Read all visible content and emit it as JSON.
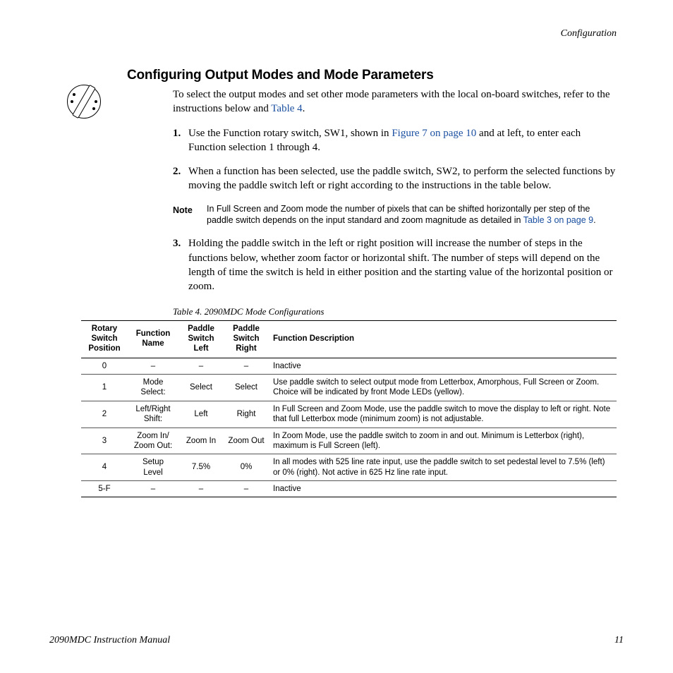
{
  "header": {
    "category": "Configuration"
  },
  "heading": "Configuring Output Modes and Mode Parameters",
  "intro": {
    "pre": "To select the output modes and set other mode parameters with the local on-board switches, refer to the instructions below and ",
    "xref": "Table 4",
    "post": "."
  },
  "steps": {
    "s1": {
      "num": "1.",
      "pre": "Use the Function rotary switch, SW1, shown in ",
      "xref": "Figure 7 on page 10",
      "post": " and at left, to enter each Function selection 1 through 4."
    },
    "s2": {
      "num": "2.",
      "text": "When a function has been selected, use the paddle switch, SW2, to perform the selected functions by moving the paddle switch left or right according to the instructions in the table below."
    },
    "s3": {
      "num": "3.",
      "text": "Holding the paddle switch in the left or right position will increase the number of steps in the functions below, whether zoom factor or horizontal shift. The number of steps will depend on the length of time the switch is held in either position and the starting value of the horizontal position or zoom."
    }
  },
  "note": {
    "label": "Note",
    "pre": "In Full Screen and Zoom mode the number of pixels that can be shifted horizontally per step of the paddle switch depends on the input standard and zoom magnitude as detailed in ",
    "xref": "Table 3 on page 9",
    "post": "."
  },
  "table": {
    "caption": "Table 4.  2090MDC Mode Configurations",
    "headers": {
      "pos": "Rotary Switch Position",
      "fn": "Function Name",
      "pl": "Paddle Switch Left",
      "pr": "Paddle Switch Right",
      "desc": "Function Description"
    },
    "rows": [
      {
        "pos": "0",
        "fn": "–",
        "pl": "–",
        "pr": "–",
        "desc": "Inactive"
      },
      {
        "pos": "1",
        "fn": "Mode Select:",
        "pl": "Select",
        "pr": "Select",
        "desc": "Use paddle switch to select output mode from Letterbox, Amorphous, Full Screen or Zoom. Choice will be indicated by front Mode LEDs (yellow)."
      },
      {
        "pos": "2",
        "fn": "Left/Right Shift:",
        "pl": "Left",
        "pr": "Right",
        "desc": "In Full Screen and Zoom Mode, use the paddle switch to move the display to left or right. Note that full Letterbox mode (minimum zoom) is not adjustable."
      },
      {
        "pos": "3",
        "fn": "Zoom In/ Zoom Out:",
        "pl": "Zoom In",
        "pr": "Zoom Out",
        "desc": "In Zoom Mode, use the paddle switch to zoom in and out. Minimum is Letterbox (right), maximum is Full Screen (left)."
      },
      {
        "pos": "4",
        "fn": "Setup Level",
        "pl": "7.5%",
        "pr": "0%",
        "desc": "In all modes with 525 line rate input, use the paddle switch to set pedestal level to 7.5% (left) or 0% (right). Not active in 625 Hz line rate input."
      },
      {
        "pos": "5-F",
        "fn": "–",
        "pl": "–",
        "pr": "–",
        "desc": "Inactive"
      }
    ]
  },
  "footer": {
    "manual": "2090MDC Instruction Manual",
    "page": "11"
  }
}
